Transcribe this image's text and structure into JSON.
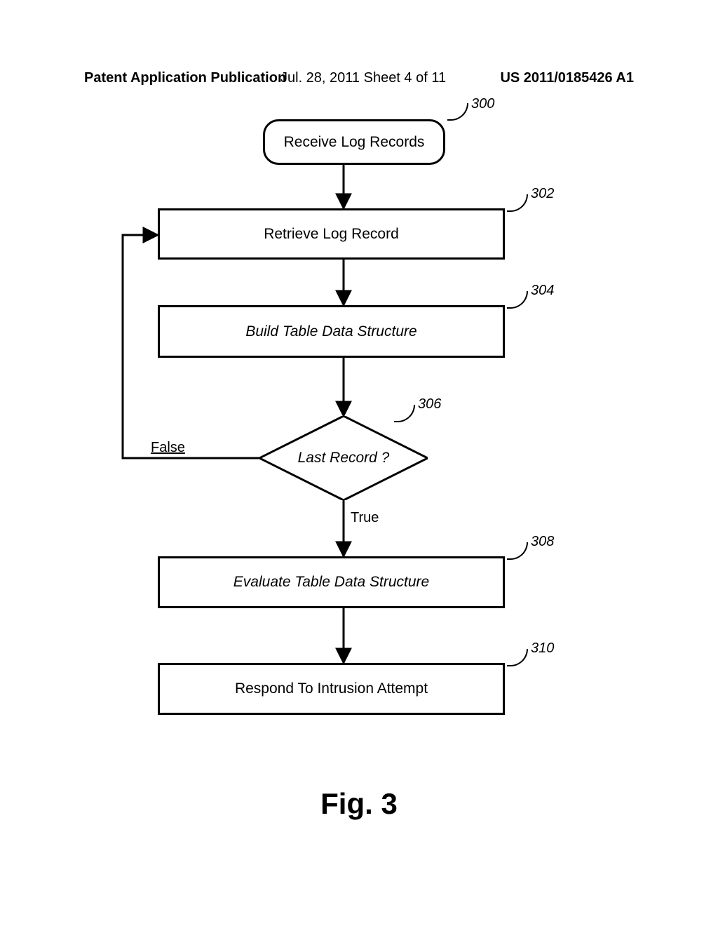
{
  "header": {
    "left": "Patent Application Publication",
    "mid": "Jul. 28, 2011   Sheet 4 of 11",
    "right": "US 2011/0185426 A1"
  },
  "flow": {
    "n300": {
      "label": "Receive Log Records",
      "ref": "300"
    },
    "n302": {
      "label": "Retrieve Log Record",
      "ref": "302"
    },
    "n304": {
      "label": "Build Table Data Structure",
      "ref": "304"
    },
    "n306": {
      "label": "Last Record ?",
      "ref": "306",
      "truelabel": "True",
      "falselabel": "False"
    },
    "n308": {
      "label": "Evaluate Table Data Structure",
      "ref": "308"
    },
    "n310": {
      "label": "Respond To Intrusion Attempt",
      "ref": "310"
    }
  },
  "caption": "Fig. 3"
}
